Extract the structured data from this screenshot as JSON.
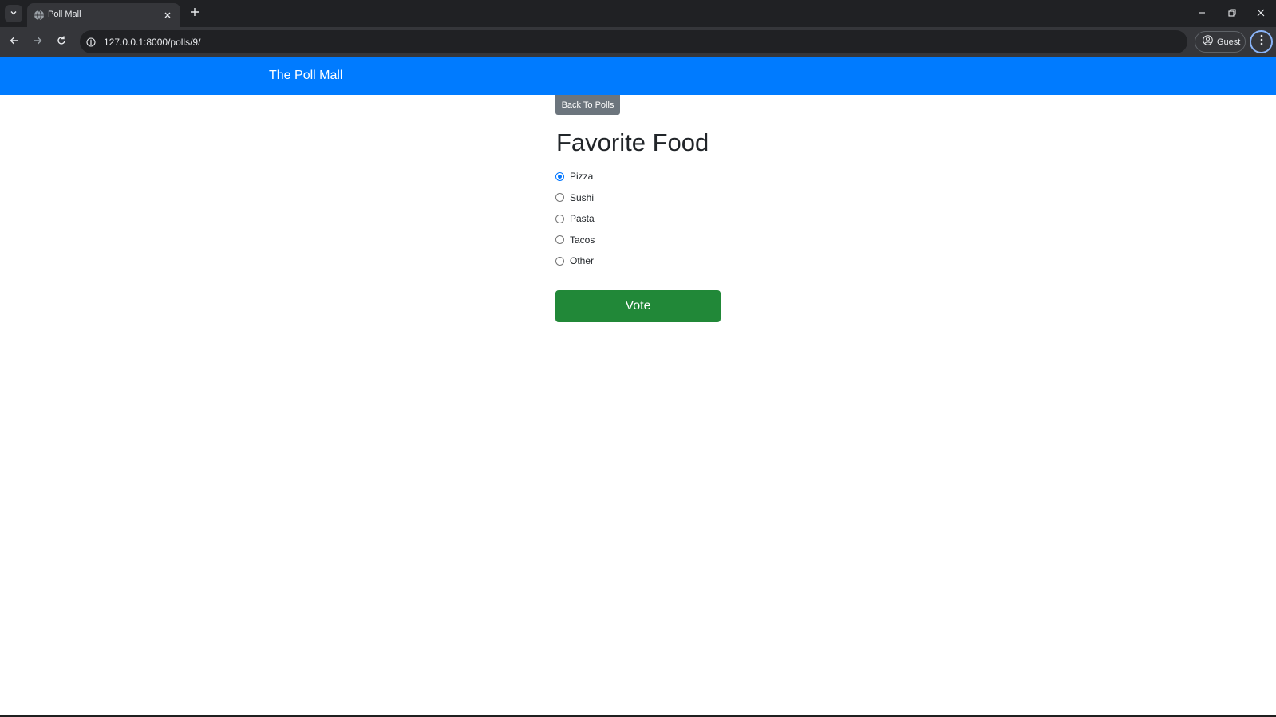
{
  "browser": {
    "tab_title": "Poll Mall",
    "url": "127.0.0.1:8000/polls/9/",
    "profile_label": "Guest"
  },
  "navbar": {
    "brand": "The Poll Mall"
  },
  "poll": {
    "back_label": "Back To Polls",
    "title": "Favorite Food",
    "choices": [
      {
        "label": "Pizza",
        "selected": true
      },
      {
        "label": "Sushi",
        "selected": false
      },
      {
        "label": "Pasta",
        "selected": false
      },
      {
        "label": "Tacos",
        "selected": false
      },
      {
        "label": "Other",
        "selected": false
      }
    ],
    "vote_label": "Vote"
  },
  "colors": {
    "navbar_bg": "#007bff",
    "back_button_bg": "#6c757d",
    "vote_button_bg": "#218838",
    "radio_accent": "#0075ff"
  },
  "icons": {
    "tab_search": "chevron-down-icon",
    "favicon": "globe-icon",
    "tab_close": "close-icon",
    "new_tab": "plus-icon",
    "back": "arrow-left-icon",
    "forward": "arrow-right-icon",
    "reload": "reload-icon",
    "site_info": "info-icon",
    "profile": "person-icon",
    "menu": "kebab-menu-icon"
  }
}
